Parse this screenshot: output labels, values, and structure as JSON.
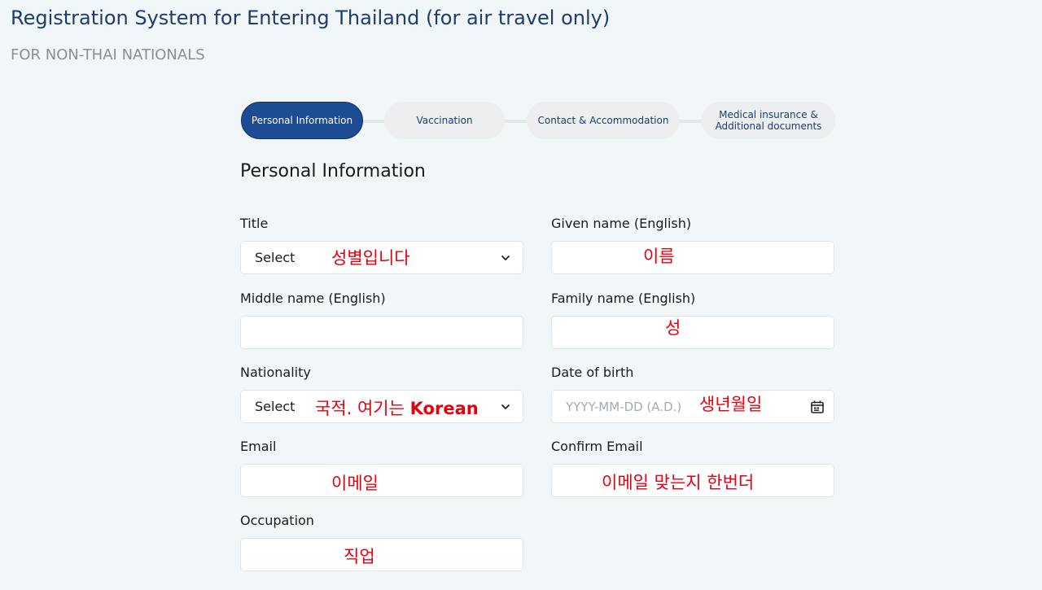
{
  "header": {
    "title": "Registration System for Entering Thailand (for air travel only)",
    "subtitle": "FOR NON-THAI NATIONALS"
  },
  "steps": [
    {
      "label": "Personal Information",
      "active": true
    },
    {
      "label": "Vaccination",
      "active": false
    },
    {
      "label": "Contact & Accommodation",
      "active": false
    },
    {
      "label": "Medical insurance & Additional documents",
      "line1": "Medical insurance &",
      "line2": "Additional documents",
      "active": false
    }
  ],
  "form": {
    "section_title": "Personal Information",
    "title": {
      "label": "Title",
      "value": "Select"
    },
    "given_name": {
      "label": "Given name (English)",
      "value": ""
    },
    "middle_name": {
      "label": "Middle name (English)",
      "value": ""
    },
    "family_name": {
      "label": "Family name (English)",
      "value": ""
    },
    "nationality": {
      "label": "Nationality",
      "value": "Select"
    },
    "date_of_birth": {
      "label": "Date of birth",
      "placeholder": "YYYY-MM-DD (A.D.)"
    },
    "email": {
      "label": "Email",
      "value": ""
    },
    "confirm_email": {
      "label": "Confirm Email",
      "value": ""
    },
    "occupation": {
      "label": "Occupation",
      "value": ""
    }
  },
  "annotations": {
    "title": "성별입니다",
    "given_name": "이름",
    "family_name": "성",
    "nationality_prefix": "국적. 여기는 ",
    "nationality_bold": "Korean",
    "date_of_birth": "생년월일",
    "email": "이메일",
    "confirm_email": "이메일 맞는지 한번더",
    "occupation": "직업",
    "color": "#e3000f"
  },
  "icons": {
    "dropdown": "chevron-down-icon",
    "date": "calendar-icon"
  }
}
